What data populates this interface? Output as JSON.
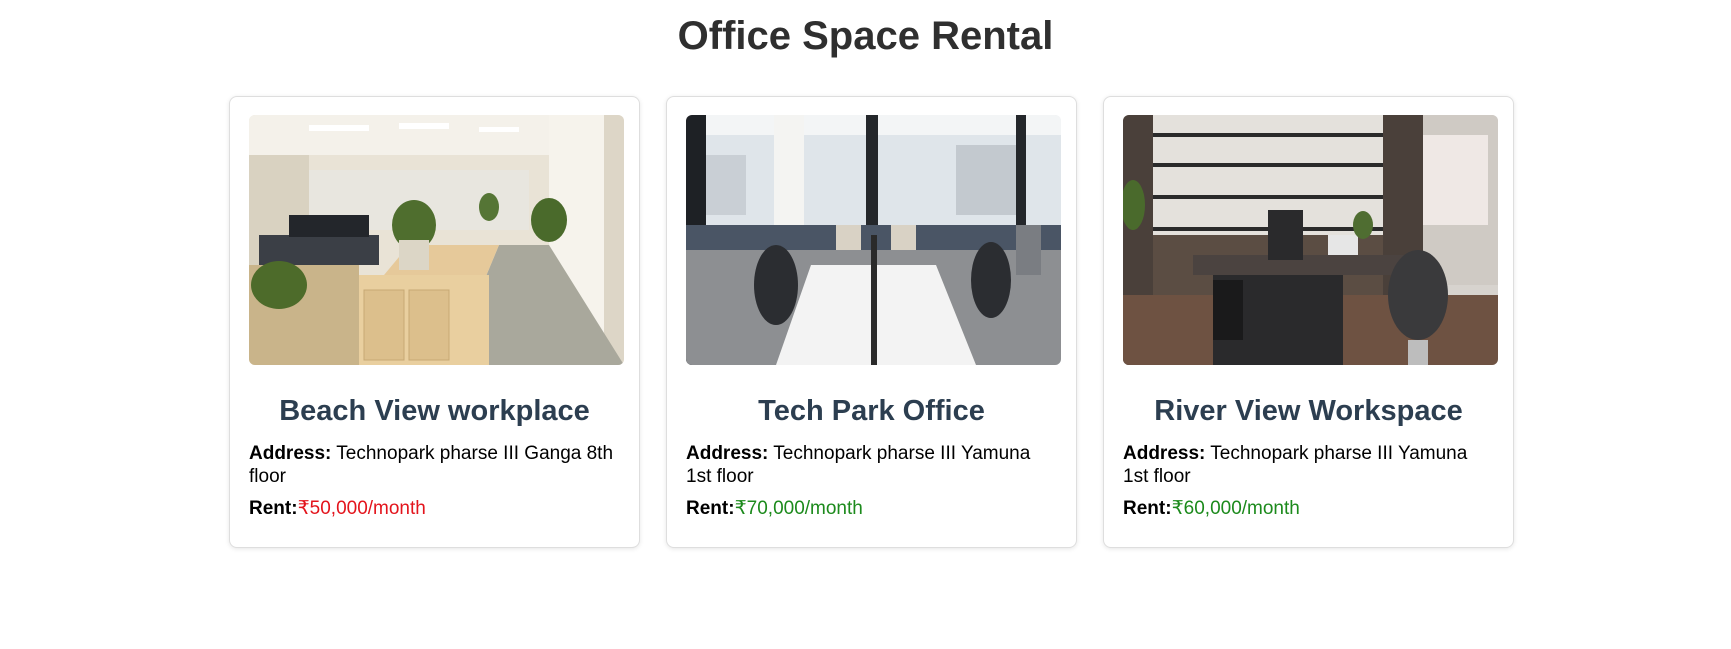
{
  "page": {
    "title": "Office Space Rental"
  },
  "cards": [
    {
      "image_icon": "open-plan-office-photo",
      "title": "Beach View workplace",
      "address_label": "Address:",
      "address_value": " Technopark pharse III Ganga 8th floor",
      "rent_label": "Rent:",
      "rent_value": "₹50,000/month",
      "rent_color": "#e3141c"
    },
    {
      "image_icon": "shared-desk-office-photo",
      "title": "Tech Park Office",
      "address_label": "Address:",
      "address_value": " Technopark pharse III Yamuna 1st floor",
      "rent_label": "Rent:",
      "rent_value": "₹70,000/month",
      "rent_color": "#1c8a1c"
    },
    {
      "image_icon": "executive-office-photo",
      "title": "River View Workspace",
      "address_label": "Address:",
      "address_value": " Technopark pharse III Yamuna 1st floor",
      "rent_label": "Rent:",
      "rent_value": "₹60,000/month",
      "rent_color": "#1c8a1c"
    }
  ]
}
